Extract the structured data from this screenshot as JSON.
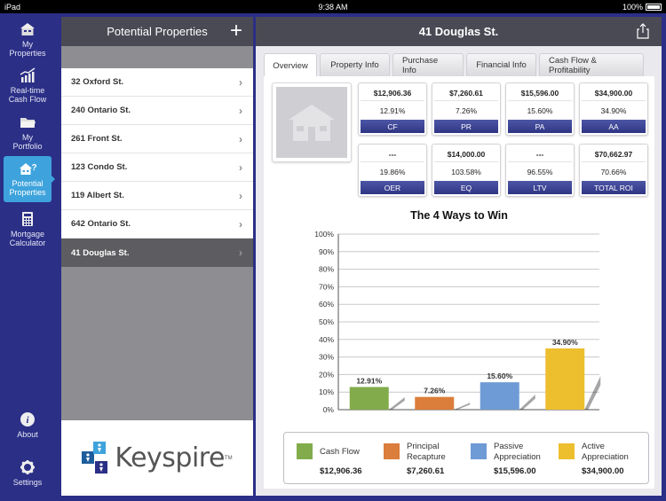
{
  "status_bar": {
    "device": "iPad",
    "time": "9:38 AM",
    "battery": "100%"
  },
  "nav_rail": {
    "items": [
      {
        "label_1": "My",
        "label_2": "Properties",
        "icon": "house-icon"
      },
      {
        "label_1": "Real-time",
        "label_2": "Cash Flow",
        "icon": "bar-chart-icon"
      },
      {
        "label_1": "My",
        "label_2": "Portfolio",
        "icon": "folder-icon"
      },
      {
        "label_1": "Potential",
        "label_2": "Properties",
        "icon": "house-question-icon",
        "active": true
      },
      {
        "label_1": "Mortgage",
        "label_2": "Calculator",
        "icon": "calculator-icon"
      }
    ],
    "about": "About",
    "settings": "Settings"
  },
  "list_pane": {
    "title": "Potential Properties",
    "add_icon": "plus-icon",
    "items": [
      "32 Oxford St.",
      "240 Ontario St.",
      "261 Front St.",
      "123 Condo St.",
      "119 Albert St.",
      "642 Ontario St.",
      "41 Douglas St."
    ],
    "selected_index": 6,
    "logo_text": "Keyspire",
    "logo_tm": "TM"
  },
  "detail": {
    "title": "41 Douglas St.",
    "tabs": [
      "Overview",
      "Property Info",
      "Purchase Info",
      "Financial Info",
      "Cash Flow & Profitability"
    ],
    "active_tab": 0,
    "metrics": [
      {
        "value": "$12,906.36",
        "percent": "12.91%",
        "label": "CF"
      },
      {
        "value": "$7,260.61",
        "percent": "7.26%",
        "label": "PR"
      },
      {
        "value": "$15,596.00",
        "percent": "15.60%",
        "label": "PA"
      },
      {
        "value": "$34,900.00",
        "percent": "34.90%",
        "label": "AA"
      },
      {
        "value": "---",
        "percent": "19.86%",
        "label": "OER"
      },
      {
        "value": "$14,000.00",
        "percent": "103.58%",
        "label": "EQ"
      },
      {
        "value": "---",
        "percent": "96.55%",
        "label": "LTV"
      },
      {
        "value": "$70,662.97",
        "percent": "70.66%",
        "label": "TOTAL ROI"
      }
    ]
  },
  "chart_data": {
    "type": "bar",
    "title": "The 4 Ways to Win",
    "categories": [
      "Cash Flow",
      "Principal Recapture",
      "Passive Appreciation",
      "Active Appreciation"
    ],
    "values": [
      12.91,
      7.26,
      15.6,
      34.9
    ],
    "data_labels": [
      "12.91%",
      "7.26%",
      "15.60%",
      "34.90%"
    ],
    "colors": [
      "#82ac4c",
      "#db7d3b",
      "#6e9bd5",
      "#edbe2e"
    ],
    "ylim": [
      0,
      100
    ],
    "yticks": [
      "0%",
      "10%",
      "20%",
      "30%",
      "40%",
      "50%",
      "60%",
      "70%",
      "80%",
      "90%",
      "100%"
    ],
    "grid": true,
    "legend": {
      "position": "bottom",
      "entries": [
        {
          "name_1": "Cash Flow",
          "name_2": "",
          "amount": "$12,906.36"
        },
        {
          "name_1": "Principal",
          "name_2": "Recapture",
          "amount": "$7,260.61"
        },
        {
          "name_1": "Passive",
          "name_2": "Appreciation",
          "amount": "$15,596.00"
        },
        {
          "name_1": "Active",
          "name_2": "Appreciation",
          "amount": "$34,900.00"
        }
      ]
    }
  }
}
